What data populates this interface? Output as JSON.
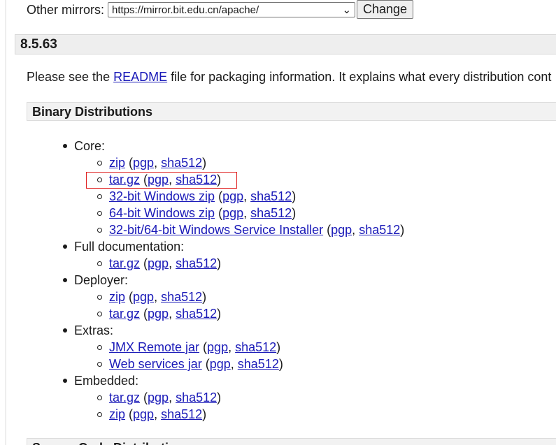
{
  "mirrors": {
    "label": "Other mirrors:",
    "selected": "https://mirror.bit.edu.cn/apache/",
    "change_label": "Change"
  },
  "version": "8.5.63",
  "intro": {
    "before": "Please see the ",
    "readme": "README",
    "after": " file for packaging information. It explains what every distribution cont"
  },
  "binary_heading": "Binary Distributions",
  "groups": [
    {
      "label": "Core:",
      "items": [
        {
          "name": "zip",
          "sig": "pgp",
          "hash": "sha512"
        },
        {
          "name": "tar.gz",
          "sig": "pgp",
          "hash": "sha512"
        },
        {
          "name": "32-bit Windows zip",
          "sig": "pgp",
          "hash": "sha512"
        },
        {
          "name": "64-bit Windows zip",
          "sig": "pgp",
          "hash": "sha512"
        },
        {
          "name": "32-bit/64-bit Windows Service Installer",
          "sig": "pgp",
          "hash": "sha512"
        }
      ]
    },
    {
      "label": "Full documentation:",
      "items": [
        {
          "name": "tar.gz",
          "sig": "pgp",
          "hash": "sha512"
        }
      ]
    },
    {
      "label": "Deployer:",
      "items": [
        {
          "name": "zip",
          "sig": "pgp",
          "hash": "sha512"
        },
        {
          "name": "tar.gz",
          "sig": "pgp",
          "hash": "sha512"
        }
      ]
    },
    {
      "label": "Extras:",
      "items": [
        {
          "name": "JMX Remote jar",
          "sig": "pgp",
          "hash": "sha512"
        },
        {
          "name": "Web services jar",
          "sig": "pgp",
          "hash": "sha512"
        }
      ]
    },
    {
      "label": "Embedded:",
      "items": [
        {
          "name": "tar.gz",
          "sig": "pgp",
          "hash": "sha512"
        },
        {
          "name": "zip",
          "sig": "pgp",
          "hash": "sha512"
        }
      ]
    }
  ],
  "source_heading": "Source Code Distributions",
  "colors": {
    "link": "#1a1ab8",
    "highlight": "#e02020",
    "header_bg": "#eeeeee"
  }
}
